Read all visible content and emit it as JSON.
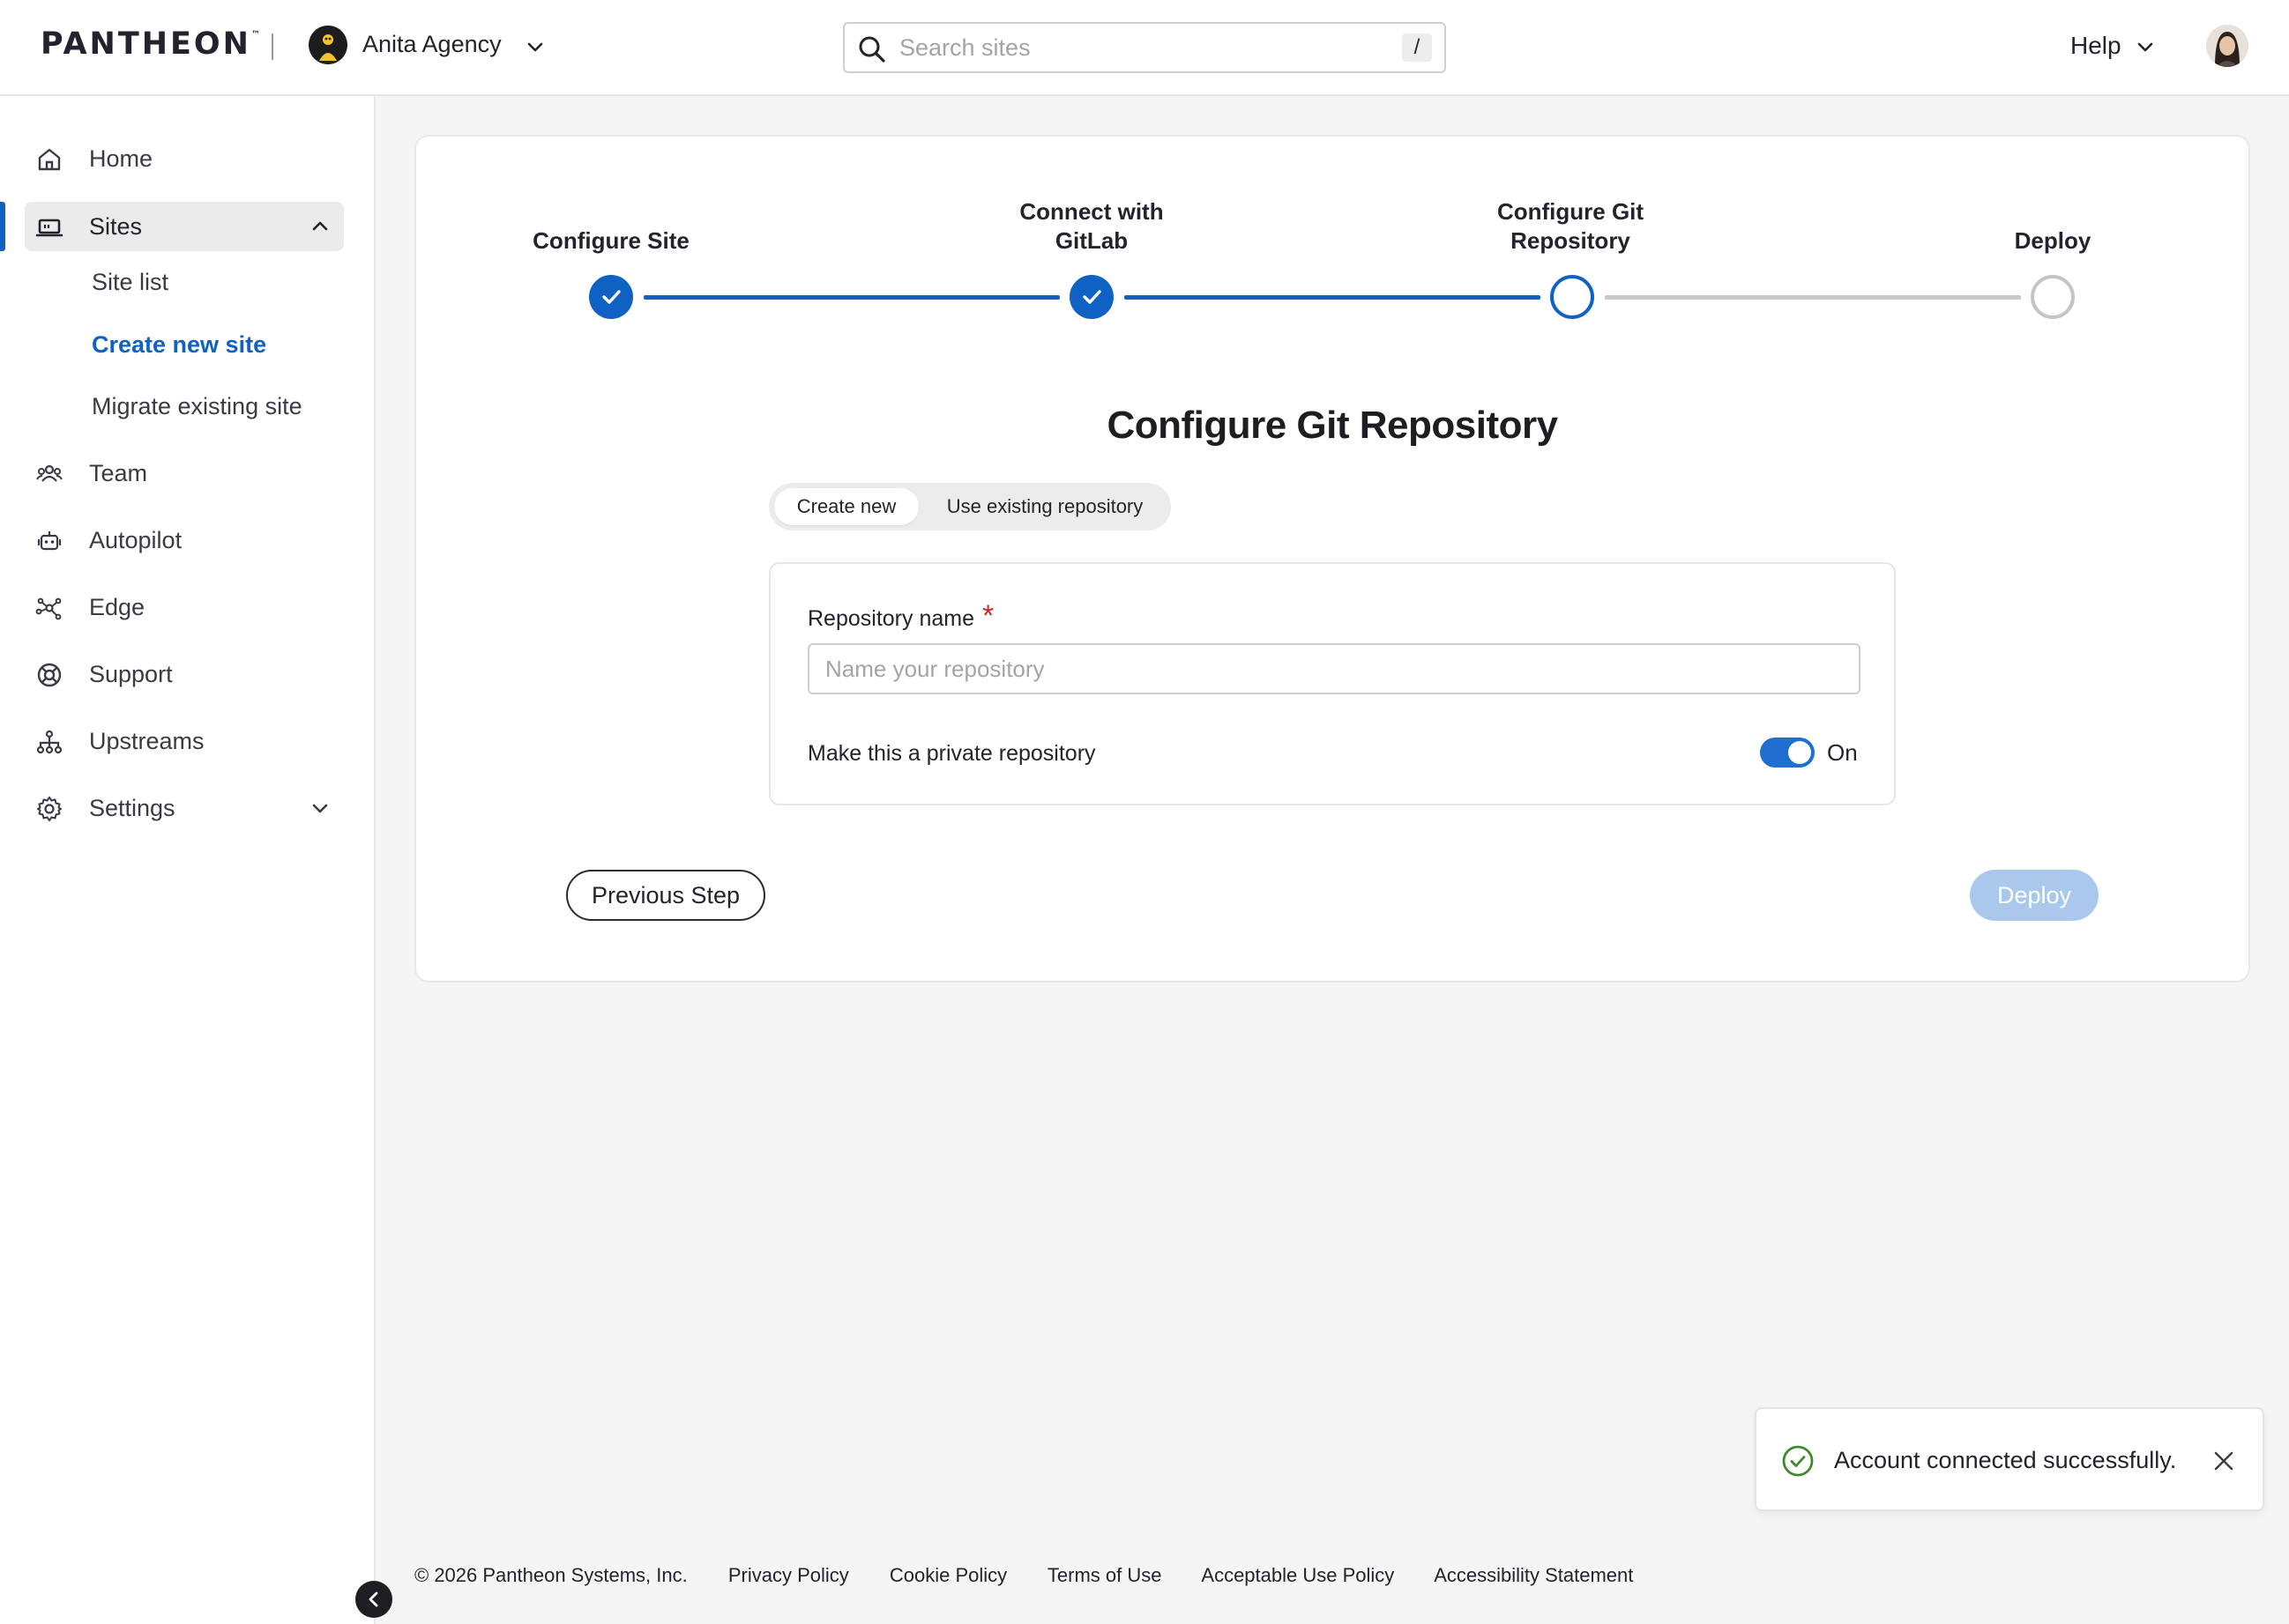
{
  "header": {
    "logo": "PANTHEON",
    "logo_tm": "™",
    "agency_name": "Anita Agency",
    "search_placeholder": "Search sites",
    "search_shortcut": "/",
    "help_label": "Help"
  },
  "sidebar": {
    "items": [
      {
        "label": "Home",
        "icon": "home-icon"
      },
      {
        "label": "Sites",
        "icon": "sites-icon",
        "expanded": true
      },
      {
        "label": "Team",
        "icon": "team-icon"
      },
      {
        "label": "Autopilot",
        "icon": "robot-icon"
      },
      {
        "label": "Edge",
        "icon": "edge-icon"
      },
      {
        "label": "Support",
        "icon": "lifebuoy-icon"
      },
      {
        "label": "Upstreams",
        "icon": "hierarchy-icon"
      },
      {
        "label": "Settings",
        "icon": "gear-icon"
      }
    ],
    "sites_sub": [
      {
        "label": "Site list"
      },
      {
        "label": "Create new site",
        "current": true
      },
      {
        "label": "Migrate existing site"
      }
    ]
  },
  "stepper": {
    "steps": [
      {
        "label": "Configure Site",
        "status": "done"
      },
      {
        "label": "Connect with GitLab",
        "status": "done"
      },
      {
        "label": "Configure Git Repository",
        "status": "current"
      },
      {
        "label": "Deploy",
        "status": "todo"
      }
    ]
  },
  "main": {
    "title": "Configure Git Repository",
    "tabs": [
      {
        "label": "Create new",
        "selected": true
      },
      {
        "label": "Use existing repository",
        "selected": false
      }
    ],
    "repo_label": "Repository name",
    "required_mark": "*",
    "repo_placeholder": "Name your repository",
    "repo_value": "",
    "private_label": "Make this a private repository",
    "private_state": "On",
    "prev_button": "Previous Step",
    "deploy_button": "Deploy"
  },
  "toast": {
    "message": "Account connected successfully."
  },
  "footer": {
    "links": [
      "© 2026 Pantheon Systems, Inc.",
      "Privacy Policy",
      "Cookie Policy",
      "Terms of Use",
      "Acceptable Use Policy",
      "Accessibility Statement"
    ]
  },
  "colors": {
    "accent": "#0f62c4",
    "toggle": "#1f6fd1",
    "deploy_disabled": "#a9c8ec",
    "success": "#3d8a2a",
    "required": "#c62828"
  }
}
